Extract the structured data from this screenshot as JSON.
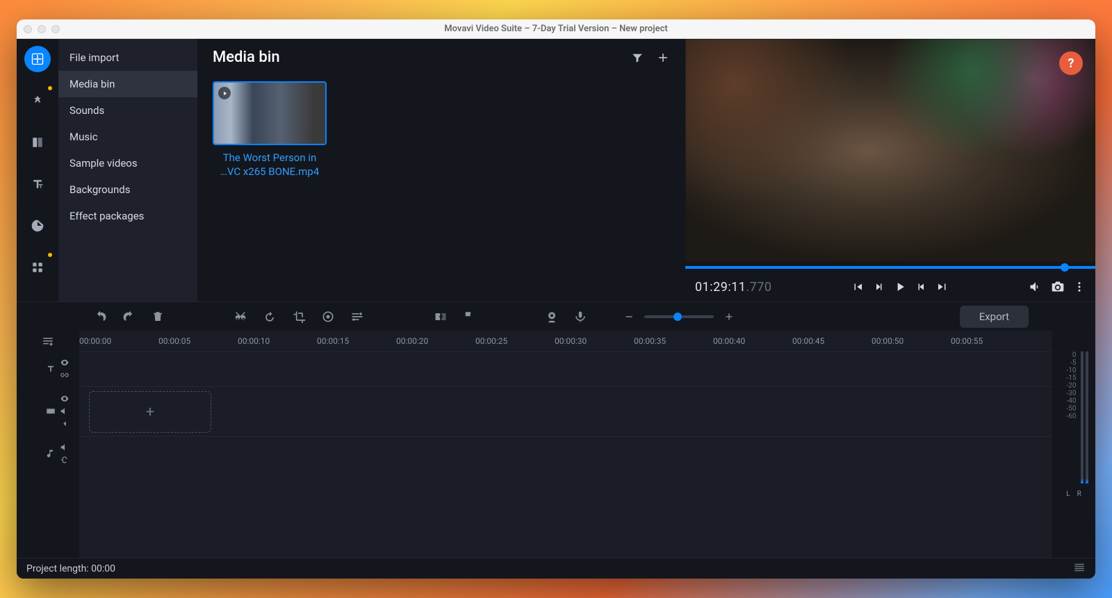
{
  "window": {
    "title": "Movavi Video Suite – 7-Day Trial Version – New project"
  },
  "sidebar": {
    "items": [
      {
        "label": "File import"
      },
      {
        "label": "Media bin",
        "active": true
      },
      {
        "label": "Sounds"
      },
      {
        "label": "Music"
      },
      {
        "label": "Sample videos"
      },
      {
        "label": "Backgrounds"
      },
      {
        "label": "Effect packages"
      }
    ]
  },
  "media": {
    "title": "Media bin",
    "clip": {
      "line1": "The Worst Person in",
      "line2": "…VC x265 BONE.mp4"
    }
  },
  "preview": {
    "timecode_main": "01:29:11",
    "timecode_frac": ".770",
    "help": "?"
  },
  "toolbar": {
    "export_label": "Export"
  },
  "ruler": {
    "ticks": [
      "00:00:00",
      "00:00:05",
      "00:00:10",
      "00:00:15",
      "00:00:20",
      "00:00:25",
      "00:00:30",
      "00:00:35",
      "00:00:40",
      "00:00:45",
      "00:00:50",
      "00:00:55"
    ]
  },
  "meters": {
    "scale": [
      "0",
      "-5",
      "-10",
      "-15",
      "-20",
      "-30",
      "-40",
      "-50",
      "-60"
    ],
    "left": "L",
    "right": "R"
  },
  "status": {
    "label": "Project length: 00:00"
  },
  "drop_plus": "+"
}
